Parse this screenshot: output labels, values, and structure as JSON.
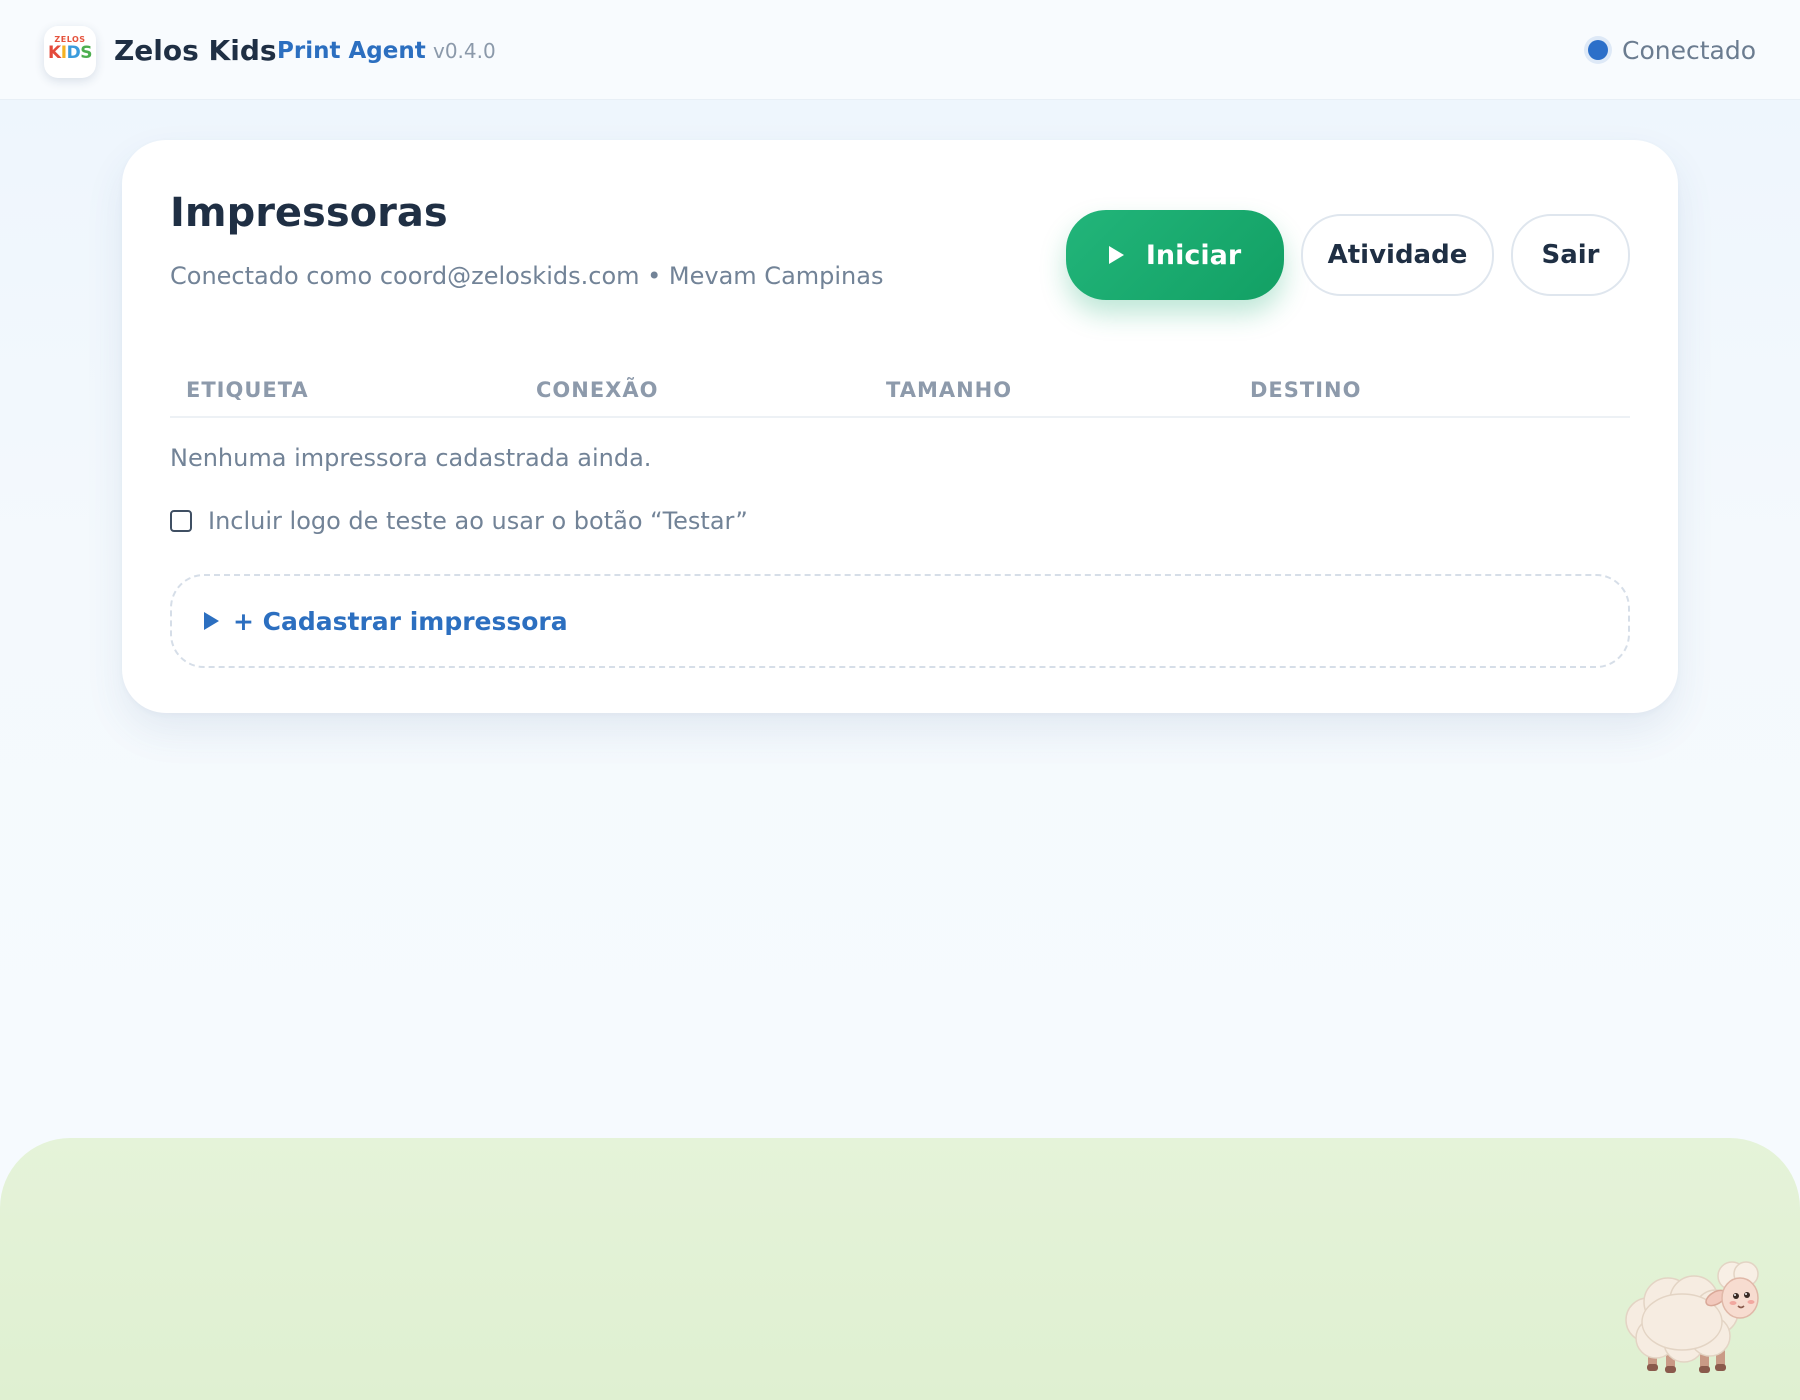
{
  "header": {
    "logo": {
      "top_text": "ZELOS",
      "kids_letters": [
        "K",
        "I",
        "D",
        "S"
      ]
    },
    "brand_name": "Zelos Kids",
    "product_name": "Print Agent",
    "version": "v0.4.0",
    "status": {
      "label": "Conectado",
      "color": "#2c6fc9"
    }
  },
  "card": {
    "title": "Impressoras",
    "subtitle": "Conectado como coord@zeloskids.com • Mevam Campinas",
    "buttons": {
      "start": "Iniciar",
      "activity": "Atividade",
      "exit": "Sair"
    },
    "table": {
      "columns": [
        "ETIQUETA",
        "CONEXÃO",
        "TAMANHO",
        "DESTINO"
      ],
      "rows": [],
      "empty_message": "Nenhuma impressora cadastrada ainda."
    },
    "test_logo_option": {
      "label": "Incluir logo de teste ao usar o botão “Testar”",
      "checked": false
    },
    "add_printer": {
      "label": "+ Cadastrar impressora",
      "expanded": false
    }
  },
  "colors": {
    "accent_green": "#1aab6e",
    "accent_blue": "#2c6fc0",
    "text_dark": "#1f2f44",
    "text_muted": "#728397",
    "grass": "#e1f0d4"
  },
  "icons": {
    "start_button": "play-icon",
    "add_printer": "caret-right-icon",
    "mascot": "sheep-illustration"
  }
}
